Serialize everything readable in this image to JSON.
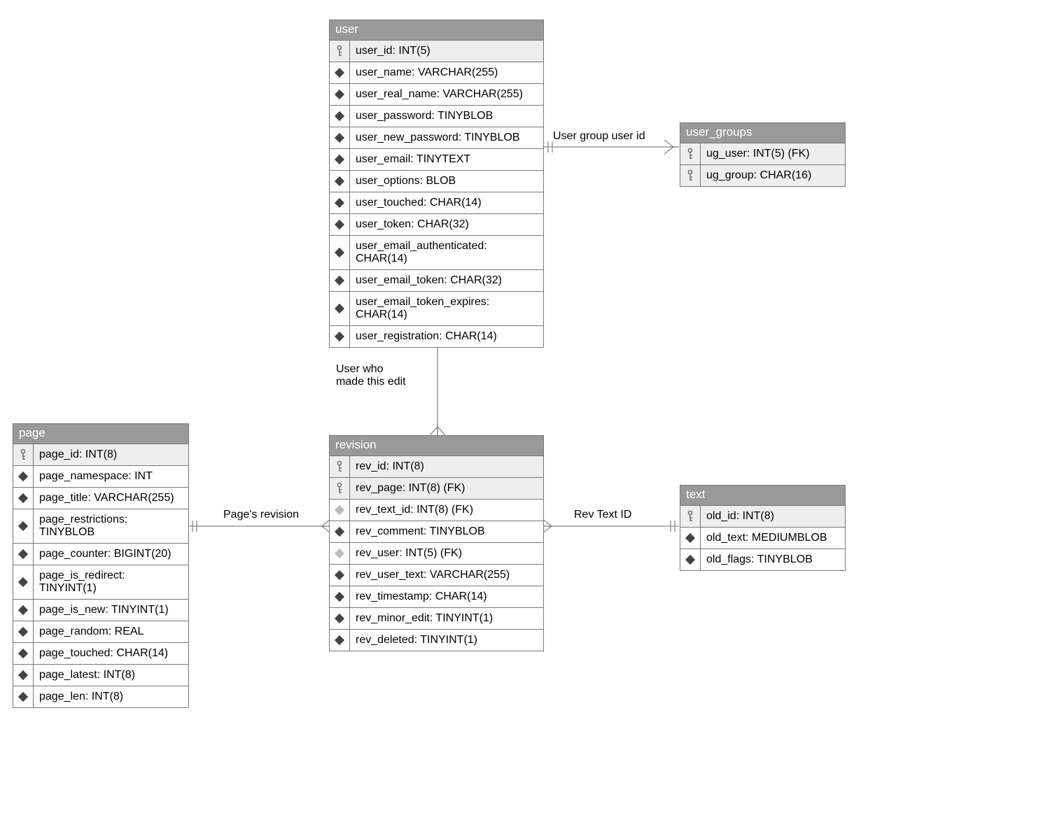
{
  "tables": {
    "user": {
      "title": "user",
      "columns": [
        {
          "key": true,
          "fk": false,
          "label": "user_id: INT(5)"
        },
        {
          "key": false,
          "fk": false,
          "label": "user_name: VARCHAR(255)"
        },
        {
          "key": false,
          "fk": false,
          "label": "user_real_name: VARCHAR(255)"
        },
        {
          "key": false,
          "fk": false,
          "label": "user_password: TINYBLOB"
        },
        {
          "key": false,
          "fk": false,
          "label": "user_new_password: TINYBLOB"
        },
        {
          "key": false,
          "fk": false,
          "label": "user_email: TINYTEXT"
        },
        {
          "key": false,
          "fk": false,
          "label": "user_options: BLOB"
        },
        {
          "key": false,
          "fk": false,
          "label": "user_touched: CHAR(14)"
        },
        {
          "key": false,
          "fk": false,
          "label": "user_token: CHAR(32)"
        },
        {
          "key": false,
          "fk": false,
          "label": "user_email_authenticated: CHAR(14)"
        },
        {
          "key": false,
          "fk": false,
          "label": "user_email_token: CHAR(32)"
        },
        {
          "key": false,
          "fk": false,
          "label": "user_email_token_expires: CHAR(14)"
        },
        {
          "key": false,
          "fk": false,
          "label": "user_registration: CHAR(14)"
        }
      ]
    },
    "user_groups": {
      "title": "user_groups",
      "columns": [
        {
          "key": true,
          "fk": true,
          "label": "ug_user: INT(5) (FK)"
        },
        {
          "key": true,
          "fk": false,
          "label": "ug_group: CHAR(16)"
        }
      ]
    },
    "page": {
      "title": "page",
      "columns": [
        {
          "key": true,
          "fk": false,
          "label": "page_id: INT(8)"
        },
        {
          "key": false,
          "fk": false,
          "label": "page_namespace: INT"
        },
        {
          "key": false,
          "fk": false,
          "label": "page_title: VARCHAR(255)"
        },
        {
          "key": false,
          "fk": false,
          "label": "page_restrictions: TINYBLOB"
        },
        {
          "key": false,
          "fk": false,
          "label": "page_counter: BIGINT(20)"
        },
        {
          "key": false,
          "fk": false,
          "label": "page_is_redirect: TINYINT(1)"
        },
        {
          "key": false,
          "fk": false,
          "label": "page_is_new: TINYINT(1)"
        },
        {
          "key": false,
          "fk": false,
          "label": "page_random: REAL"
        },
        {
          "key": false,
          "fk": false,
          "label": "page_touched: CHAR(14)"
        },
        {
          "key": false,
          "fk": false,
          "label": "page_latest: INT(8)"
        },
        {
          "key": false,
          "fk": false,
          "label": "page_len: INT(8)"
        }
      ]
    },
    "revision": {
      "title": "revision",
      "columns": [
        {
          "key": true,
          "fk": false,
          "label": "rev_id: INT(8)"
        },
        {
          "key": true,
          "fk": true,
          "label": "rev_page: INT(8) (FK)"
        },
        {
          "key": false,
          "fk": true,
          "label": "rev_text_id: INT(8) (FK)"
        },
        {
          "key": false,
          "fk": false,
          "label": "rev_comment: TINYBLOB"
        },
        {
          "key": false,
          "fk": true,
          "label": "rev_user: INT(5) (FK)"
        },
        {
          "key": false,
          "fk": false,
          "label": "rev_user_text: VARCHAR(255)"
        },
        {
          "key": false,
          "fk": false,
          "label": "rev_timestamp: CHAR(14)"
        },
        {
          "key": false,
          "fk": false,
          "label": "rev_minor_edit: TINYINT(1)"
        },
        {
          "key": false,
          "fk": false,
          "label": "rev_deleted: TINYINT(1)"
        }
      ]
    },
    "text": {
      "title": "text",
      "columns": [
        {
          "key": true,
          "fk": false,
          "label": "old_id: INT(8)"
        },
        {
          "key": false,
          "fk": false,
          "label": "old_text: MEDIUMBLOB"
        },
        {
          "key": false,
          "fk": false,
          "label": "old_flags: TINYBLOB"
        }
      ]
    }
  },
  "relationships": {
    "user_groups_user": "User group user id",
    "user_revision": "User who\nmade this edit",
    "page_revision": "Page's revision",
    "revision_text": "Rev Text ID"
  }
}
